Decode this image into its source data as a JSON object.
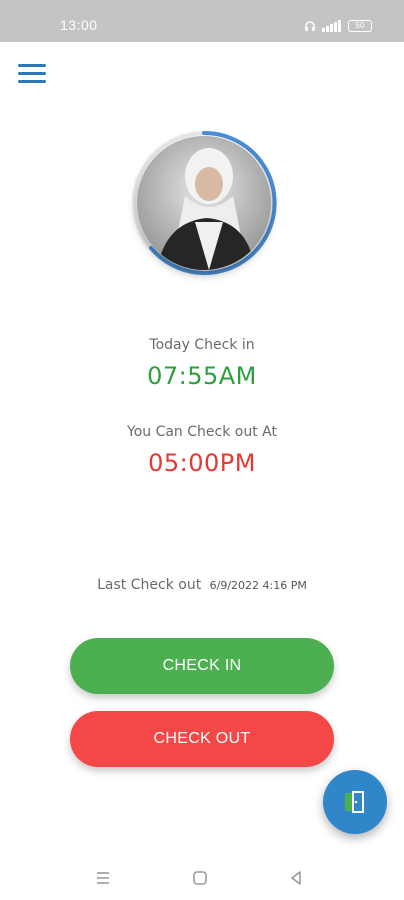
{
  "status_bar": {
    "time": "13:00",
    "battery": "50",
    "icons": [
      "headphones-icon",
      "signal-icon",
      "battery-icon"
    ]
  },
  "menu": {
    "icon": "hamburger-menu-icon"
  },
  "profile": {
    "avatar": "user-avatar-photo"
  },
  "checkin": {
    "label": "Today Check in",
    "time": "07:55AM"
  },
  "checkout_info": {
    "label": "You Can Check out At",
    "time": "05:00PM"
  },
  "last_checkout": {
    "label": "Last Check out",
    "datetime": "6/9/2022 4:16 PM"
  },
  "buttons": {
    "check_in": "CHECK IN",
    "check_out": "CHECK OUT"
  },
  "fab": {
    "icon": "exit-door-icon"
  },
  "nav": [
    "recents-icon",
    "home-icon",
    "back-icon"
  ],
  "colors": {
    "accent": "#2f87c9",
    "green": "#4caf50",
    "red": "#f44848"
  }
}
